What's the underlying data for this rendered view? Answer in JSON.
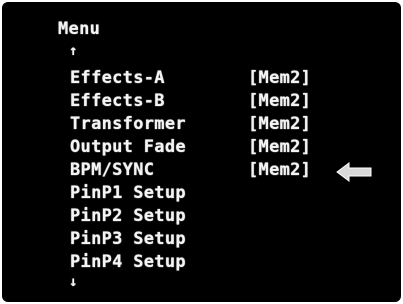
{
  "menu": {
    "title": "Menu",
    "scroll_up": "↑",
    "scroll_down": "↓",
    "items": [
      {
        "label": "Effects-A",
        "value": "[Mem2]"
      },
      {
        "label": "Effects-B",
        "value": "[Mem2]"
      },
      {
        "label": "Transformer",
        "value": "[Mem2]"
      },
      {
        "label": "Output Fade",
        "value": "[Mem2]"
      },
      {
        "label": "BPM/SYNC",
        "value": "[Mem2]"
      },
      {
        "label": "PinP1 Setup",
        "value": ""
      },
      {
        "label": "PinP2 Setup",
        "value": ""
      },
      {
        "label": "PinP3 Setup",
        "value": ""
      },
      {
        "label": "PinP4 Setup",
        "value": ""
      }
    ],
    "highlighted_item": "BPM/SYNC"
  },
  "colors": {
    "screen_bg": "#000000",
    "text": "#f4f4f4",
    "pointer_arrow": "#d9d9d9"
  },
  "icons": {
    "pointer": "left-arrow-icon"
  }
}
